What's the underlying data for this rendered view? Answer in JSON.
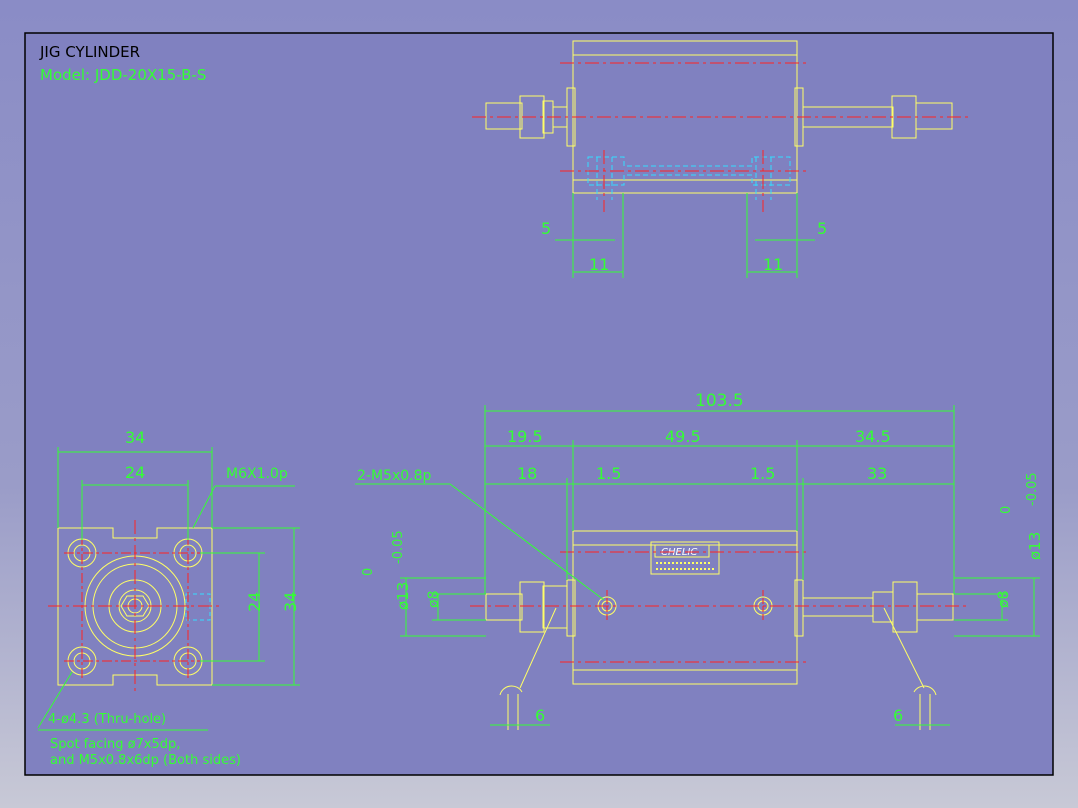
{
  "title": "JIG CYLINDER",
  "model": "Model: JDD-20X15-B-S",
  "colors": {
    "background": "#8081c0",
    "frame": "#000000",
    "body_line": "#ffff66",
    "dimension": "#33ff33",
    "center_line": "#ff2222",
    "hidden_line": "#33ddff",
    "title_text": "#000000"
  },
  "top_view": {
    "dim_left_5": "5",
    "dim_right_5": "5",
    "dim_left_11": "11",
    "dim_right_11": "11"
  },
  "end_view": {
    "dim_34_top": "34",
    "dim_24_top": "24",
    "dim_24_side": "24",
    "dim_34_side": "34",
    "thread_note": "M6X1.0p",
    "hole_note_1": "4-ø4.3 (Thru-hole)",
    "hole_note_2": "Spot facing ø7x5dp,",
    "hole_note_3": "and M5x0.8x6dp (Both sides)"
  },
  "side_view": {
    "overall_length": "103.5",
    "dim_19_5": "19.5",
    "dim_49_5": "49.5",
    "dim_34_5": "34.5",
    "dim_18": "18",
    "dim_1_5_left": "1.5",
    "dim_1_5_right": "1.5",
    "dim_33": "33",
    "port_note": "2-M5x0.8p",
    "tol_left_upper": "0",
    "tol_left_lower": "-0.05",
    "dia_left": "ø13",
    "dia_left_rod": "ø8",
    "tol_right_upper": "0",
    "tol_right_lower": "-0.05",
    "dia_right": "ø13",
    "dia_right_rod": "ø8",
    "dim_6_left": "6",
    "dim_6_right": "6",
    "brand_label": "CHELIC"
  }
}
